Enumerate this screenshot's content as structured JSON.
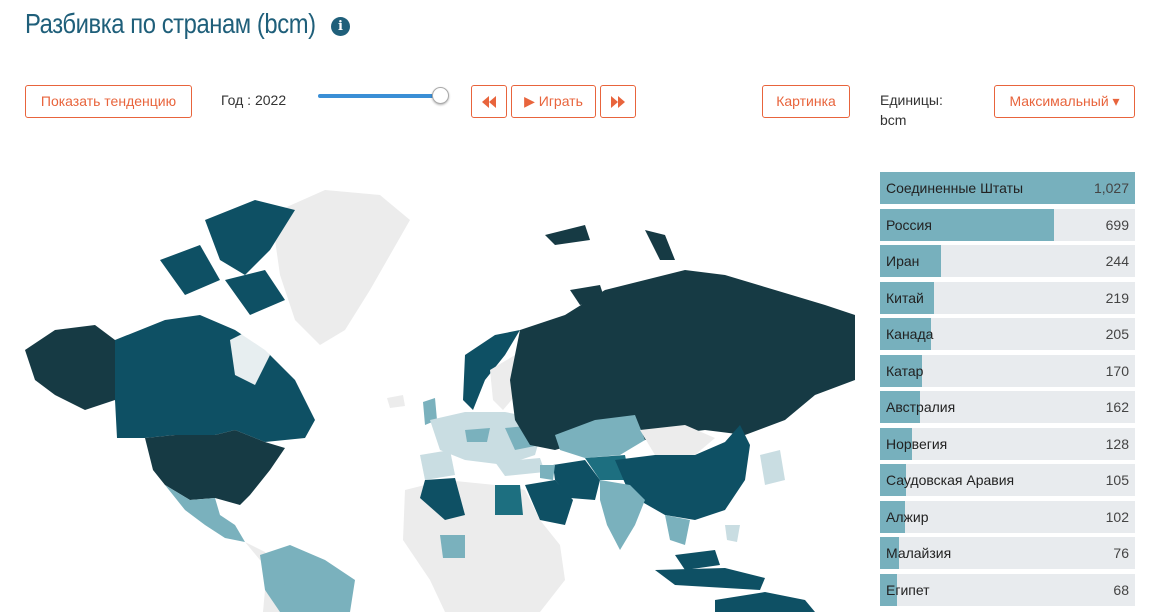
{
  "title": "Разбивка по странам (bcm)",
  "info_icon": "info-icon",
  "controls": {
    "trend_label": "Показать тенденцию",
    "year_label": "Год : 2022",
    "rewind_icon": "rewind-icon",
    "play_label": "▶ Играть",
    "forward_icon": "fast-forward-icon",
    "image_label": "Картинка",
    "units_label": "Единицы: bcm",
    "max_label": "Максимальный ▾"
  },
  "colors": {
    "accent": "#e8643c",
    "title": "#1f5f7a",
    "bar": "#77b0bd",
    "bar_bg": "#e8ebee",
    "map_darkest": "#163a44",
    "map_dark": "#0e5064",
    "map_mid": "#1d6f80",
    "map_light": "#7ab1bd",
    "map_lighter": "#c9dde2",
    "map_none": "#ececec"
  },
  "ranking": [
    {
      "name": "Соединенные Штаты",
      "value": "1,027",
      "num": 1027
    },
    {
      "name": "Россия",
      "value": "699",
      "num": 699
    },
    {
      "name": "Иран",
      "value": "244",
      "num": 244
    },
    {
      "name": "Китай",
      "value": "219",
      "num": 219
    },
    {
      "name": "Канада",
      "value": "205",
      "num": 205
    },
    {
      "name": "Катар",
      "value": "170",
      "num": 170
    },
    {
      "name": "Австралия",
      "value": "162",
      "num": 162
    },
    {
      "name": "Норвегия",
      "value": "128",
      "num": 128
    },
    {
      "name": "Саудовская Аравия",
      "value": "105",
      "num": 105
    },
    {
      "name": "Алжир",
      "value": "102",
      "num": 102
    },
    {
      "name": "Малайзия",
      "value": "76",
      "num": 76
    },
    {
      "name": "Египет",
      "value": "68",
      "num": 68
    }
  ]
}
